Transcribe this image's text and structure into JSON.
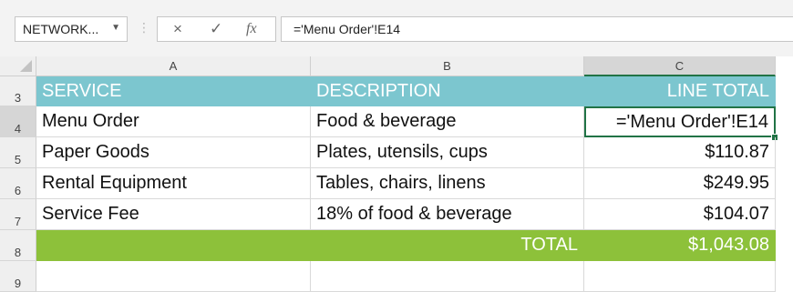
{
  "formula_bar": {
    "name_box": "NETWORK...",
    "dropdown_icon": "chevron-down-icon",
    "cancel_icon": "×",
    "enter_icon": "✓",
    "fx_label": "fx",
    "formula": "='Menu Order'!E14"
  },
  "columns": [
    "A",
    "B",
    "C"
  ],
  "rows": [
    {
      "num": "3",
      "a": "SERVICE",
      "b": "DESCRIPTION",
      "c": "LINE TOTAL"
    },
    {
      "num": "4",
      "a": "Menu Order",
      "b": "Food & beverage",
      "c": "='Menu Order'!E14"
    },
    {
      "num": "5",
      "a": "Paper Goods",
      "b": "Plates, utensils, cups",
      "c": "$110.87"
    },
    {
      "num": "6",
      "a": "Rental Equipment",
      "b": "Tables, chairs, linens",
      "c": "$249.95"
    },
    {
      "num": "7",
      "a": "Service Fee",
      "b": "18% of food & beverage",
      "c": "$104.07"
    },
    {
      "num": "8",
      "a": "",
      "b": "TOTAL",
      "c": "$1,043.08"
    },
    {
      "num": "9",
      "a": "",
      "b": "",
      "c": ""
    }
  ],
  "colors": {
    "header_fill": "#7cc6cf",
    "total_fill": "#8dc13a",
    "selection": "#217346"
  }
}
